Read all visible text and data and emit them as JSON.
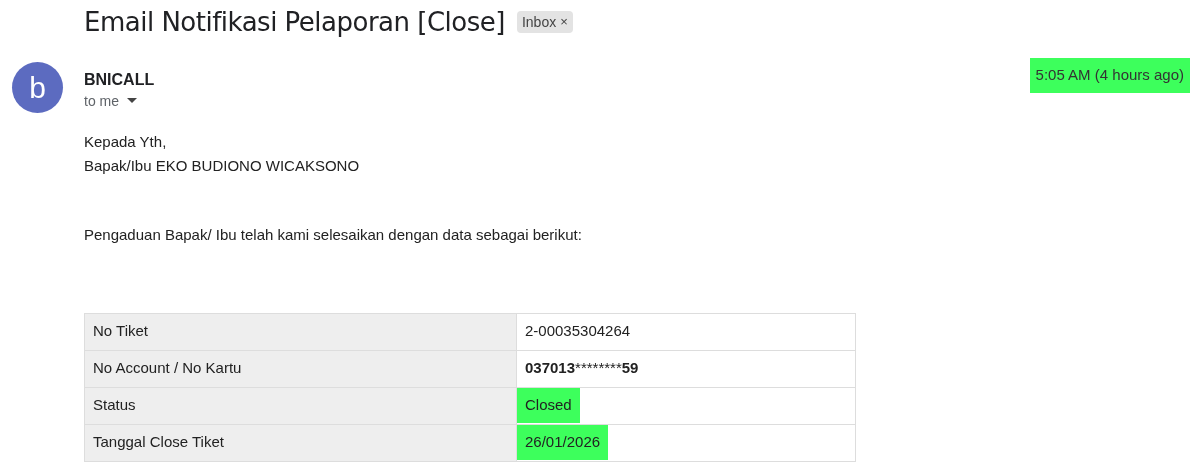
{
  "subject": "Email Notifikasi Pelaporan [Close]",
  "label": {
    "text": "Inbox",
    "remove": "×"
  },
  "sender": {
    "avatar_letter": "b",
    "name": "BNICALL",
    "recipient": "to me",
    "time": "5:05 AM (4 hours ago)",
    "time_highlighted": true
  },
  "greeting": [
    "Kepada Yth,",
    "Bapak/Ibu EKO BUDIONO WICAKSONO"
  ],
  "message": "Pengaduan Bapak/ Ibu telah kami selesaikan dengan data sebagai berikut:",
  "table": [
    {
      "label": "No Tiket",
      "value_parts": [
        {
          "text": "2-00035304264",
          "bold": false
        }
      ],
      "highlighted": false
    },
    {
      "label": "No Account / No Kartu",
      "value_parts": [
        {
          "text": "037013",
          "bold": true
        },
        {
          "text": "********",
          "bold": false
        },
        {
          "text": "59",
          "bold": true
        }
      ],
      "highlighted": false
    },
    {
      "label": "Status",
      "value_parts": [
        {
          "text": "Closed",
          "bold": false
        }
      ],
      "highlighted": true
    },
    {
      "label": "Tanggal Close Tiket",
      "value_parts": [
        {
          "text": "26/01/2026",
          "bold": false
        }
      ],
      "highlighted": true
    }
  ]
}
